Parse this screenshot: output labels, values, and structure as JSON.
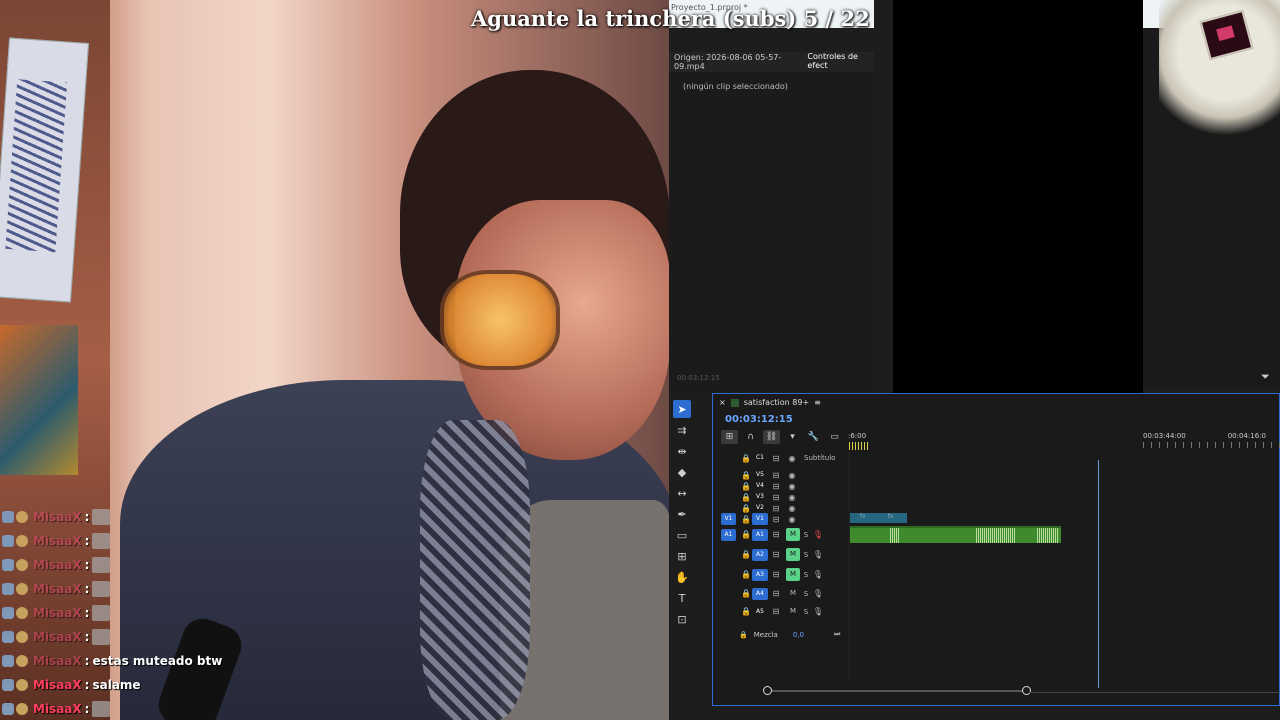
{
  "stream": {
    "title": "Aguante la trinchera (subs) 5 / 22"
  },
  "chat": {
    "messages": [
      {
        "user": "MisaaX",
        "sep": ":",
        "text": "",
        "emote": true,
        "style": "faded"
      },
      {
        "user": "MisaaX",
        "sep": ":",
        "text": "",
        "emote": true,
        "style": "faded"
      },
      {
        "user": "MisaaX",
        "sep": ":",
        "text": "",
        "emote": true,
        "style": "faded"
      },
      {
        "user": "MisaaX",
        "sep": ":",
        "text": "",
        "emote": true,
        "style": "faded"
      },
      {
        "user": "MisaaX",
        "sep": ":",
        "text": "",
        "emote": true,
        "style": "faded"
      },
      {
        "user": "MisaaX",
        "sep": ":",
        "text": "",
        "emote": true,
        "style": "faded"
      },
      {
        "user": "MisaaX",
        "sep": ":",
        "text": "estas muteado btw",
        "emote": false,
        "style": "faded"
      },
      {
        "user": "MisaaX",
        "sep": ":",
        "text": "salame",
        "emote": false,
        "style": "solid"
      },
      {
        "user": "MisaaX",
        "sep": ":",
        "text": "",
        "emote": true,
        "style": "solid"
      }
    ]
  },
  "premiere": {
    "project_tab": "Proyecto_1.prproj *",
    "source_label": "Origen: 2026-08-06 05-57-09.mp4",
    "effect_controls_tab": "Controles de efect",
    "no_clip": "(ningún clip seleccionado)",
    "effect_timecode": "00:03:12:15",
    "sequence_name": "satisfaction 89+",
    "sequence_menu": "≡",
    "timeline_timecode": "00:03:12:15",
    "ruler_left": ":6:00",
    "ruler_marks": [
      "00:03:44:00",
      "00:04:16:0"
    ],
    "subtitle_track": {
      "name": "C1",
      "label": "Subtítulo"
    },
    "video_tracks": [
      "V5",
      "V4",
      "V3",
      "V2",
      "V1"
    ],
    "audio_tracks": [
      {
        "target": "A1",
        "name": "A1",
        "m": "M",
        "s": "S"
      },
      {
        "target": "",
        "name": "A2",
        "m": "M",
        "s": "S"
      },
      {
        "target": "",
        "name": "A3",
        "m": "M",
        "s": "S"
      },
      {
        "target": "",
        "name": "A4",
        "m": "M",
        "s": "S"
      },
      {
        "target": "",
        "name": "A5",
        "m": "M",
        "s": "S"
      }
    ],
    "video_target": "V1",
    "mix_label": "Mezcla",
    "mix_value": "0,0",
    "clip_fx_label": "fx"
  },
  "colors": {
    "accent_blue": "#2d6dd2",
    "mute_green": "#5bd28a",
    "timecode_blue": "#6aa8ff",
    "chat_user": "#ff3f5f"
  }
}
